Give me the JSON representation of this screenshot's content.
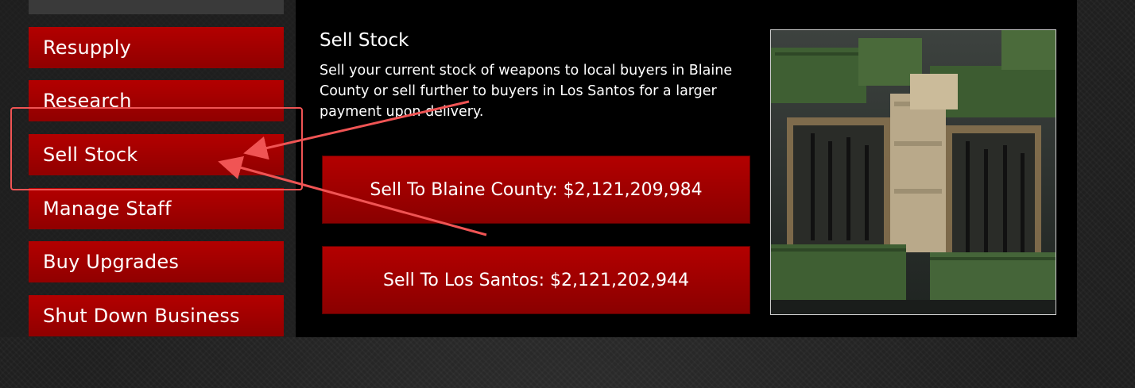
{
  "menu": {
    "items": [
      {
        "label": "Resupply"
      },
      {
        "label": "Research"
      },
      {
        "label": "Sell Stock"
      },
      {
        "label": "Manage Staff"
      },
      {
        "label": "Buy Upgrades"
      },
      {
        "label": "Shut Down Business"
      }
    ]
  },
  "panel": {
    "title": "Sell Stock",
    "description": "Sell your current stock of weapons to local buyers in Blaine County or sell further to buyers in Los Santos for a larger payment upon delivery.",
    "buttons": {
      "blaine": "Sell To Blaine County: $2,121,209,984",
      "los_santos": "Sell To Los Santos: $2,121,202,944"
    }
  },
  "colors": {
    "menu_red": "#a00000",
    "annotation": "#f05454",
    "panel_bg": "#000000"
  },
  "icons": {
    "preview": "weapon-crates-image",
    "annotation": "arrow-annotation-icon"
  }
}
